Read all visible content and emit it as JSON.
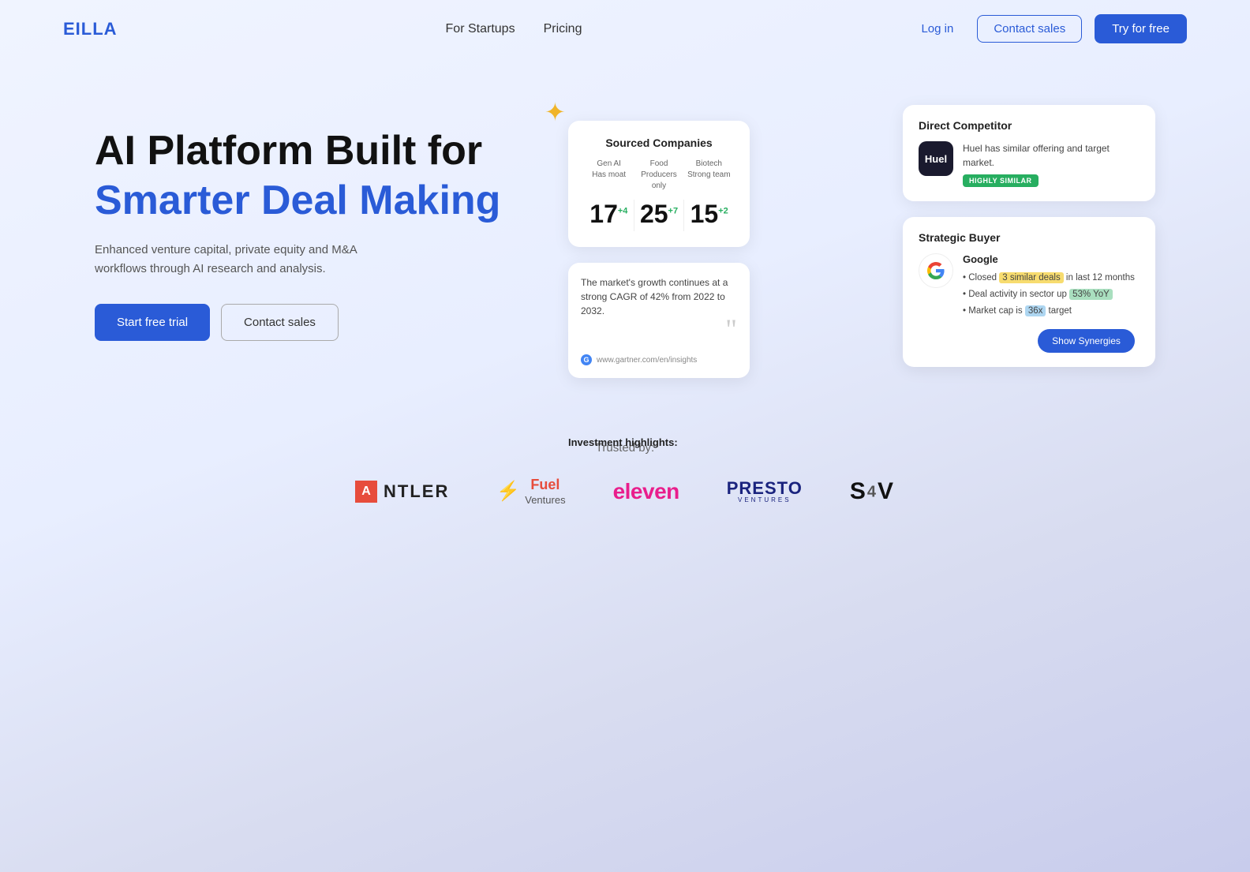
{
  "brand": {
    "name": "EILLA"
  },
  "nav": {
    "links": [
      {
        "label": "For Startups",
        "id": "for-startups"
      },
      {
        "label": "Pricing",
        "id": "pricing"
      }
    ],
    "login_label": "Log in",
    "contact_label": "Contact sales",
    "try_label": "Try for free"
  },
  "hero": {
    "title_black": "AI Platform Built for",
    "title_blue": "Smarter Deal Making",
    "subtitle": "Enhanced venture capital, private equity and M&A workflows through AI research and analysis.",
    "start_trial_label": "Start free trial",
    "contact_label": "Contact sales"
  },
  "sourced_card": {
    "title": "Sourced Companies",
    "col1_label": "Gen AI",
    "col1_sub": "Has moat",
    "col2_label": "Food",
    "col2_sub": "Producers only",
    "col3_label": "Biotech",
    "col3_sub": "Strong team",
    "num1": "17",
    "num1_delta": "+4",
    "num2": "25",
    "num2_delta": "+7",
    "num3": "15",
    "num3_delta": "+2"
  },
  "investment_card": {
    "title": "Investment highlights:",
    "quote": "The market's growth continues at a strong CAGR of 42% from 2022 to 2032.",
    "source": "www.gartner.com/en/insights"
  },
  "competitor_card": {
    "title": "Direct Competitor",
    "company": "Huel",
    "description": "Huel has similar offering and target market.",
    "badge": "HIGHLY SIMILAR"
  },
  "strategic_card": {
    "title": "Strategic Buyer",
    "company": "Google",
    "bullet1_pre": "Closed ",
    "bullet1_highlight": "3 similar deals",
    "bullet1_post": " in last 12 months",
    "bullet2_pre": "Deal activity in sector up ",
    "bullet2_highlight": "53% YoY",
    "bullet3_pre": "Market cap is ",
    "bullet3_highlight": "36x",
    "bullet3_post": " target",
    "synergies_label": "Show Synergies"
  },
  "trusted": {
    "label": "Trusted by:",
    "logos": [
      {
        "name": "Antler",
        "id": "antler"
      },
      {
        "name": "Fuel Ventures",
        "id": "fuel-ventures"
      },
      {
        "name": "eleven",
        "id": "eleven"
      },
      {
        "name": "PRESTO VENTURES",
        "id": "presto"
      },
      {
        "name": "SAV",
        "id": "sav"
      }
    ]
  }
}
